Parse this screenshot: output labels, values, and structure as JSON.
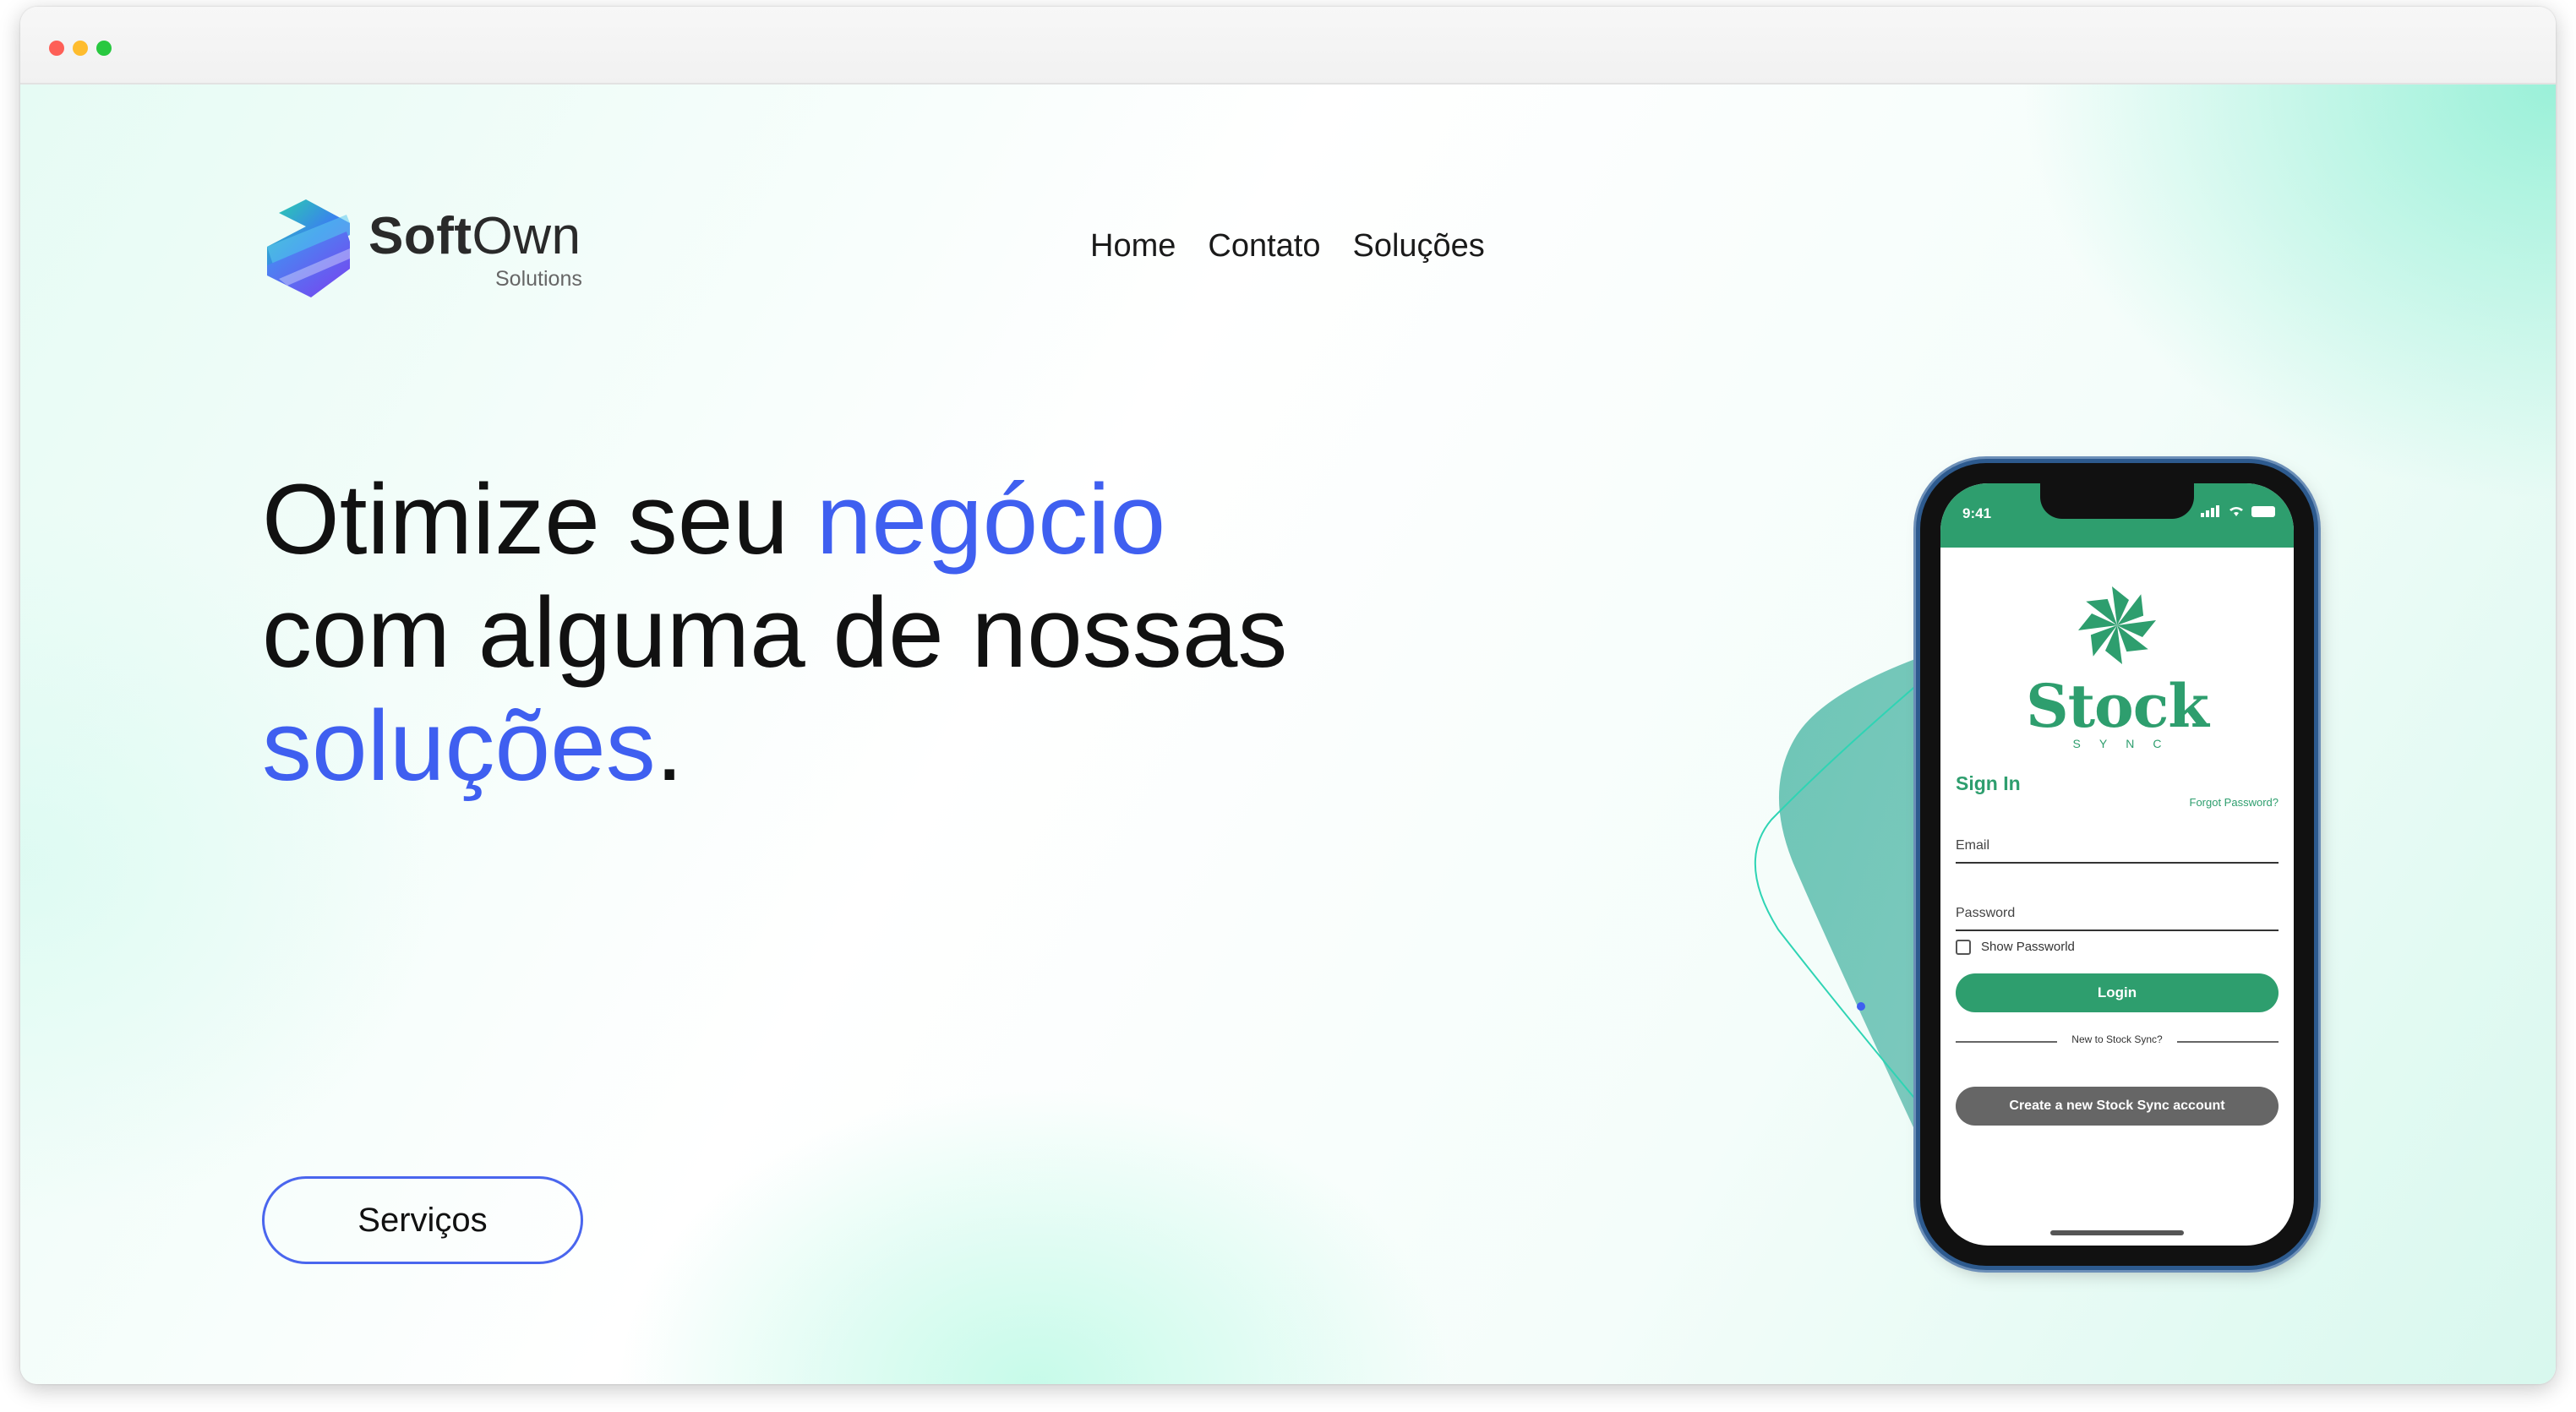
{
  "brand": {
    "name_bold": "Soft",
    "name_light": "Own",
    "subtitle": "Solutions"
  },
  "nav": {
    "items": [
      {
        "label": "Home"
      },
      {
        "label": "Contato"
      },
      {
        "label": "Soluções"
      }
    ]
  },
  "hero": {
    "line1_part1": "Otimize seu ",
    "line1_accent": "negócio",
    "line2": "com alguma de nossas",
    "line3_accent": "soluções",
    "line3_end": ".",
    "button_label": "Serviços"
  },
  "phone": {
    "time": "9:41",
    "app_name": "Stock",
    "app_subtitle": "SYNC",
    "signin_title": "Sign In",
    "forgot_link": "Forgot Password?",
    "email_label": "Email",
    "password_label": "Password",
    "show_password_label": "Show Passworld",
    "login_button": "Login",
    "new_user_text": "New to Stock Sync?",
    "create_button": "Create a new Stock Sync account"
  },
  "colors": {
    "accent_blue": "#3f5ff0",
    "brand_green": "#2e9e6e",
    "gray_button": "#666666"
  },
  "icons": {
    "logo": "softown-s-logo-icon",
    "app_logo": "stock-pinwheel-icon",
    "signal": "signal-bars-icon",
    "wifi": "wifi-icon",
    "battery": "battery-icon"
  }
}
